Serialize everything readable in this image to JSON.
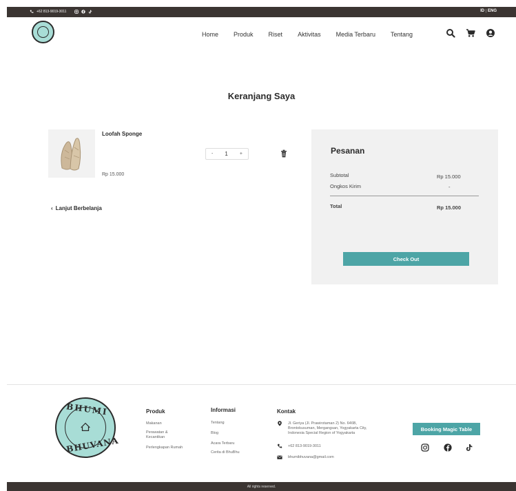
{
  "topbar": {
    "phone": "+62 813-9019-3011",
    "lang_id": "ID",
    "lang_sep": "|",
    "lang_eng": "ENG"
  },
  "nav": {
    "items": [
      {
        "label": "Home"
      },
      {
        "label": "Produk"
      },
      {
        "label": "Riset"
      },
      {
        "label": "Aktivitas"
      },
      {
        "label": "Media Terbaru"
      },
      {
        "label": "Tentang"
      }
    ]
  },
  "page_title": "Keranjang Saya",
  "cart": {
    "item": {
      "name": "Loofah Sponge",
      "price": "Rp 15.000",
      "qty": "1",
      "minus": "-",
      "plus": "+"
    },
    "continue_label": "Lanjut Berbelanja"
  },
  "summary": {
    "title": "Pesanan",
    "subtotal_label": "Subtotal",
    "subtotal_value": "Rp 15.000",
    "shipping_label": "Ongkos Kirim",
    "shipping_value": "-",
    "total_label": "Total",
    "total_value": "Rp 15.000",
    "checkout_label": "Check Out"
  },
  "footer": {
    "logo_top": "BHUMI",
    "logo_bottom": "BHUVANA",
    "produk": {
      "title": "Produk",
      "links": [
        "Makanan",
        "Perawatan &",
        "Kecantikan",
        "Perlengkapan Rumah"
      ]
    },
    "informasi": {
      "title": "Informasi",
      "links": [
        "Tentang",
        "Blog",
        "Acara Terbaru",
        "Cerita di BhuBhu"
      ]
    },
    "kontak": {
      "title": "Kontak",
      "address_1": "Jl. Geriya (Jl. Prawirotaman 2) No. 646B,",
      "address_2": "Brontokusuman, Mergangsan, Yogyakarta City,",
      "address_3": "Indonesia Special Region of Yogyakarta",
      "phone": "+62 813-9019-3011",
      "email": "bhumibhuvana@gmail.com"
    },
    "booking_label": "Booking Magic Table",
    "copyright": "All rights reserved."
  },
  "colors": {
    "accent": "#4da5a6",
    "dark_bar": "#3b3532",
    "logo_bg": "#a8ddd6"
  },
  "icons": [
    "phone-icon",
    "instagram-icon",
    "facebook-icon",
    "tiktok-icon",
    "search-icon",
    "cart-icon",
    "user-icon",
    "trash-icon",
    "chevron-left-icon",
    "location-icon",
    "email-icon"
  ]
}
